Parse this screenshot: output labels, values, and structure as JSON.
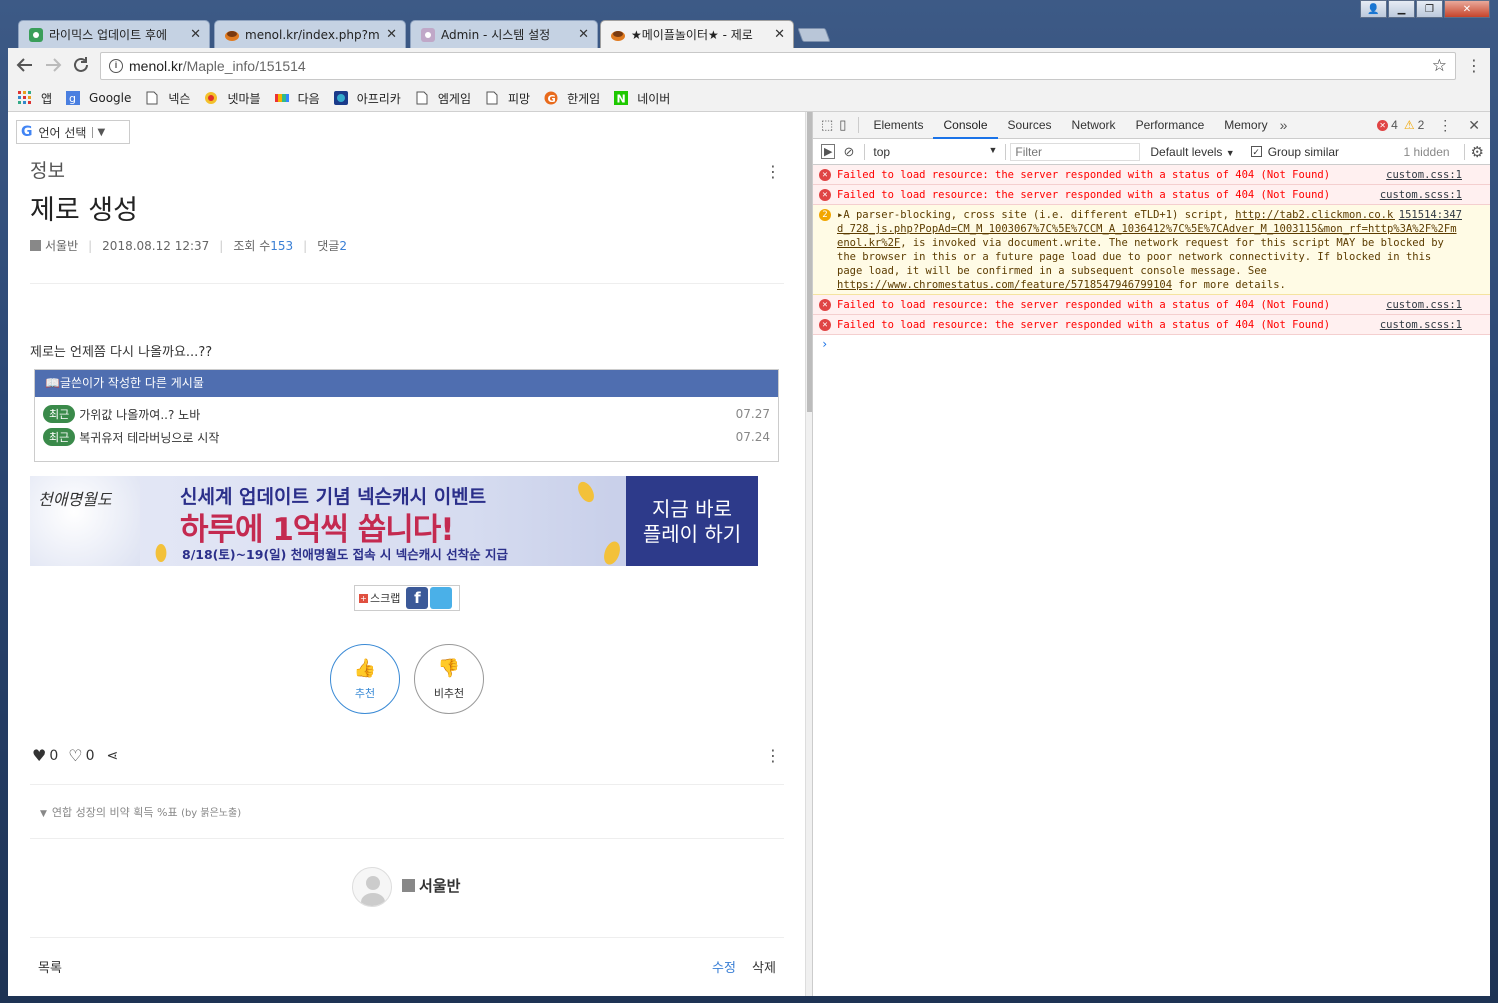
{
  "browser": {
    "tabs": [
      {
        "title": "라이믹스 업데이트 후에",
        "icon": "rhymix-icon",
        "color": "#3a9e5a"
      },
      {
        "title": "menol.kr/index.php?moc",
        "icon": "menol-icon",
        "color": "#e07a1f"
      },
      {
        "title": "Admin - 시스템 설정",
        "icon": "rhymix-icon",
        "color": "#c0a8c8"
      },
      {
        "title": "★메이플놀이터★ - 제로",
        "icon": "menol-icon",
        "color": "#e07a1f"
      }
    ],
    "url_domain": "menol.kr",
    "url_path": "/Maple_info/151514",
    "bookmarks": [
      {
        "label": "앱",
        "icon": "apps-icon"
      },
      {
        "label": "Google",
        "icon": "google-icon"
      },
      {
        "label": "넥슨",
        "icon": "page-icon"
      },
      {
        "label": "넷마블",
        "icon": "netmarble-icon"
      },
      {
        "label": "다음",
        "icon": "daum-icon"
      },
      {
        "label": "아프리카",
        "icon": "afreeca-icon"
      },
      {
        "label": "엠게임",
        "icon": "page-icon"
      },
      {
        "label": "피망",
        "icon": "page-icon"
      },
      {
        "label": "한게임",
        "icon": "hangame-icon"
      },
      {
        "label": "네이버",
        "icon": "naver-icon"
      }
    ]
  },
  "post": {
    "translate_label": "언어 선택",
    "category": "정보",
    "title": "제로 생성",
    "author": "서울반",
    "date": "2018.08.12 12:37",
    "views_label": "조회 수",
    "views": "153",
    "comments_label": "댓글",
    "comments": "2",
    "body": "제로는 언제쯤 다시 나올까요...??",
    "other_posts_header": "글쓴이가 작성한 다른 게시물",
    "other_posts": [
      {
        "badge": "최근",
        "title": "가위값 나올까여..? 노바",
        "date": "07.27"
      },
      {
        "badge": "최근",
        "title": "복귀유저 테라버닝으로 시작",
        "date": "07.24"
      }
    ],
    "ad": {
      "logo": "천애명월도",
      "line1": "신세계 업데이트 기념 넥슨캐시 이벤트",
      "line2": "하루에 1억씩 쏩니다!",
      "line3": "8/18(토)~19(일) 천애명월도 접속 시 넥슨캐시 선착순 지급",
      "cta1": "지금 바로",
      "cta2": "플레이 하기"
    },
    "scrap_label": "스크랩",
    "recommend_label": "추천",
    "not_recommend_label": "비추천",
    "likes": "0",
    "dislikes": "0",
    "related": "연합 성장의 비약 획득 %표",
    "related_by": "(by 붉은노출)",
    "author_box_name": "서울반",
    "list_label": "목록",
    "edit_label": "수정",
    "delete_label": "삭제"
  },
  "devtools": {
    "tabs": [
      "Elements",
      "Console",
      "Sources",
      "Network",
      "Performance",
      "Memory"
    ],
    "active_tab": "Console",
    "error_count": "4",
    "warning_count": "2",
    "context": "top",
    "filter_placeholder": "Filter",
    "levels": "Default levels",
    "group_similar": "Group similar",
    "hidden": "1 hidden",
    "messages": [
      {
        "type": "error",
        "text": "Failed to load resource: the server responded with a status of 404 (Not Found)",
        "source": "custom.css:1"
      },
      {
        "type": "error",
        "text": "Failed to load resource: the server responded with a status of 404 (Not Found)",
        "source": "custom.scss:1"
      },
      {
        "type": "error",
        "text": "Failed to load resource: the server responded with a status of 404 (Not Found)",
        "source": "custom.css:1"
      },
      {
        "type": "error",
        "text": "Failed to load resource: the server responded with a status of 404 (Not Found)",
        "source": "custom.scss:1"
      }
    ],
    "warning": {
      "count": "2",
      "prefix": "A parser-blocking, cross site (i.e. different eTLD+1) script, ",
      "link": "http://tab2.clickmon.co.kr/pop/wp_ad_728_js.php?PopAd=CM_M_1003067%7C%5E%7CCM_A_1036412%7C%5E%7CAdver_M_1003115&mon_rf=http%3A%2F%2Fmenol.kr%2F",
      "middle": ", is invoked via document.write. The network request for this script MAY be blocked by the browser in this or a future page load due to poor network connectivity. If blocked in this page load, it will be confirmed in a subsequent console message. See ",
      "link2": "https://www.chromestatus.com/feature/5718547946799104",
      "suffix": " for more details.",
      "source": "151514:347"
    }
  }
}
